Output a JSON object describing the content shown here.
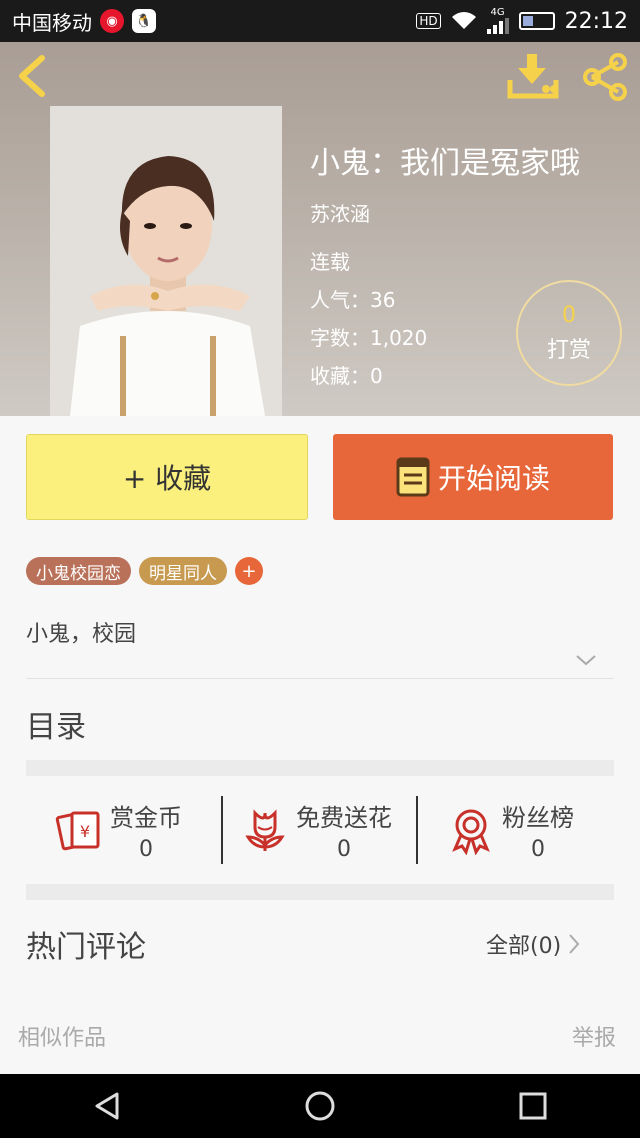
{
  "status_bar": {
    "carrier": "中国移动",
    "network": "4G",
    "hd": "HD",
    "time": "22:12"
  },
  "book": {
    "title": "小鬼：我们是冤家哦",
    "author": "苏浓涵",
    "status": "连载",
    "popularity": "人气：36",
    "words": "字数：1,020",
    "favorites": "收藏：0",
    "reward_count": "0",
    "reward_label": "打赏"
  },
  "actions": {
    "favorite_label": "+ 收藏",
    "read_label": "开始阅读"
  },
  "tags": [
    "小鬼校园恋",
    "明星同人"
  ],
  "tag_add": "+",
  "intro": "小鬼，校园",
  "toc_title": "目录",
  "stats": [
    {
      "label": "赏金币",
      "value": "0",
      "icon": "red-envelope-icon"
    },
    {
      "label": "免费送花",
      "value": "0",
      "icon": "flower-icon"
    },
    {
      "label": "粉丝榜",
      "value": "0",
      "icon": "medal-icon"
    }
  ],
  "comments": {
    "title": "热门评论",
    "all_link": "全部(0)"
  },
  "footer": {
    "similar": "相似作品",
    "report": "举报"
  },
  "colors": {
    "accent_yellow": "#f6d24a",
    "read_button": "#e8673a",
    "fav_button": "#fbf07e",
    "tag_1": "#b9715a",
    "tag_2": "#c89a50",
    "icon_red": "#c8302a"
  }
}
